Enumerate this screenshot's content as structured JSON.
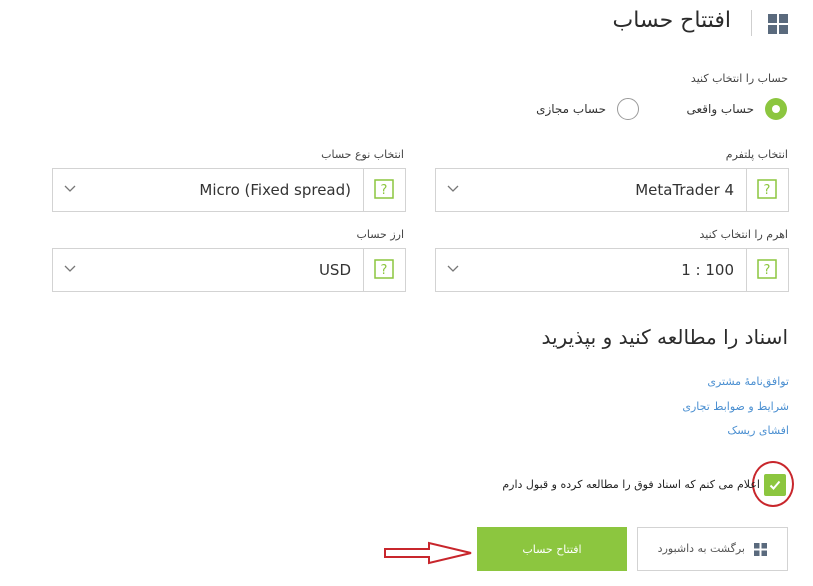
{
  "header": {
    "title": "افتتاح حساب",
    "menu_icon": "grid-icon"
  },
  "account": {
    "label": "حساب را انتخاب کنید",
    "options": [
      {
        "label": "حساب واقعی",
        "selected": true
      },
      {
        "label": "حساب مجازی",
        "selected": false
      }
    ]
  },
  "fields": {
    "platform": {
      "label": "انتخاب پلتفرم",
      "value": "MetaTrader 4"
    },
    "account_type": {
      "label": "انتخاب نوع حساب",
      "value": "Micro (Fixed spread)"
    },
    "leverage": {
      "label": "اهرم را انتخاب کنید",
      "value": "1 : 100"
    },
    "currency": {
      "label": "ارز حساب",
      "value": "USD"
    }
  },
  "documents": {
    "title": "اسناد را مطالعه کنید و بپذیرید",
    "links": [
      "توافق‌نامهٔ مشتری",
      "شرایط و ضوابط تجاری",
      "افشای ریسک"
    ]
  },
  "agreement": {
    "label": "اعلام می کنم که اسناد فوق را مطالعه کرده و قبول دارم",
    "checked": true
  },
  "buttons": {
    "open_account": "افتتاح حساب",
    "back_dashboard": "برگشت به داشبورد"
  },
  "colors": {
    "accent": "#8cc63f",
    "link": "#4a8fd1",
    "annotation": "#c8262c"
  }
}
